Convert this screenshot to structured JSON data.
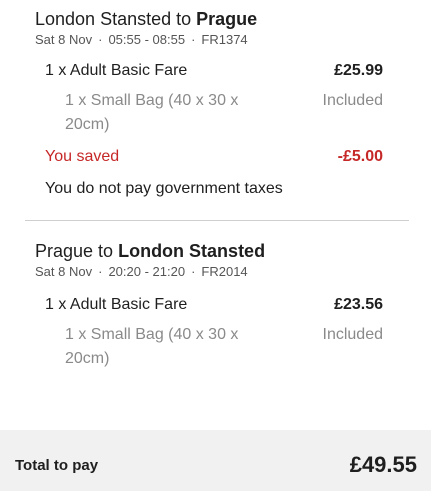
{
  "legs": [
    {
      "route_from": "London Stansted to",
      "route_to": "Prague",
      "date": "Sat 8 Nov",
      "times": "05:55 - 08:55",
      "flight": "FR1374",
      "fare_label": "1 x Adult Basic Fare",
      "fare_amount": "£25.99",
      "bag_label": "1 x Small Bag (40 x 30 x 20cm)",
      "bag_value": "Included",
      "saved_label": "You saved",
      "saved_amount": "-£5.00",
      "tax_note": "You do not pay government taxes"
    },
    {
      "route_from": "Prague to",
      "route_to": "London Stansted",
      "date": "Sat 8 Nov",
      "times": "20:20 - 21:20",
      "flight": "FR2014",
      "fare_label": "1 x Adult Basic Fare",
      "fare_amount": "£23.56",
      "bag_label": "1 x Small Bag (40 x 30 x 20cm)",
      "bag_value": "Included"
    }
  ],
  "separator": "·",
  "total": {
    "label": "Total to pay",
    "amount": "£49.55"
  },
  "colors": {
    "saving": "#c62828",
    "muted": "#8a8a8a",
    "total_bg": "#f1f1f1"
  }
}
